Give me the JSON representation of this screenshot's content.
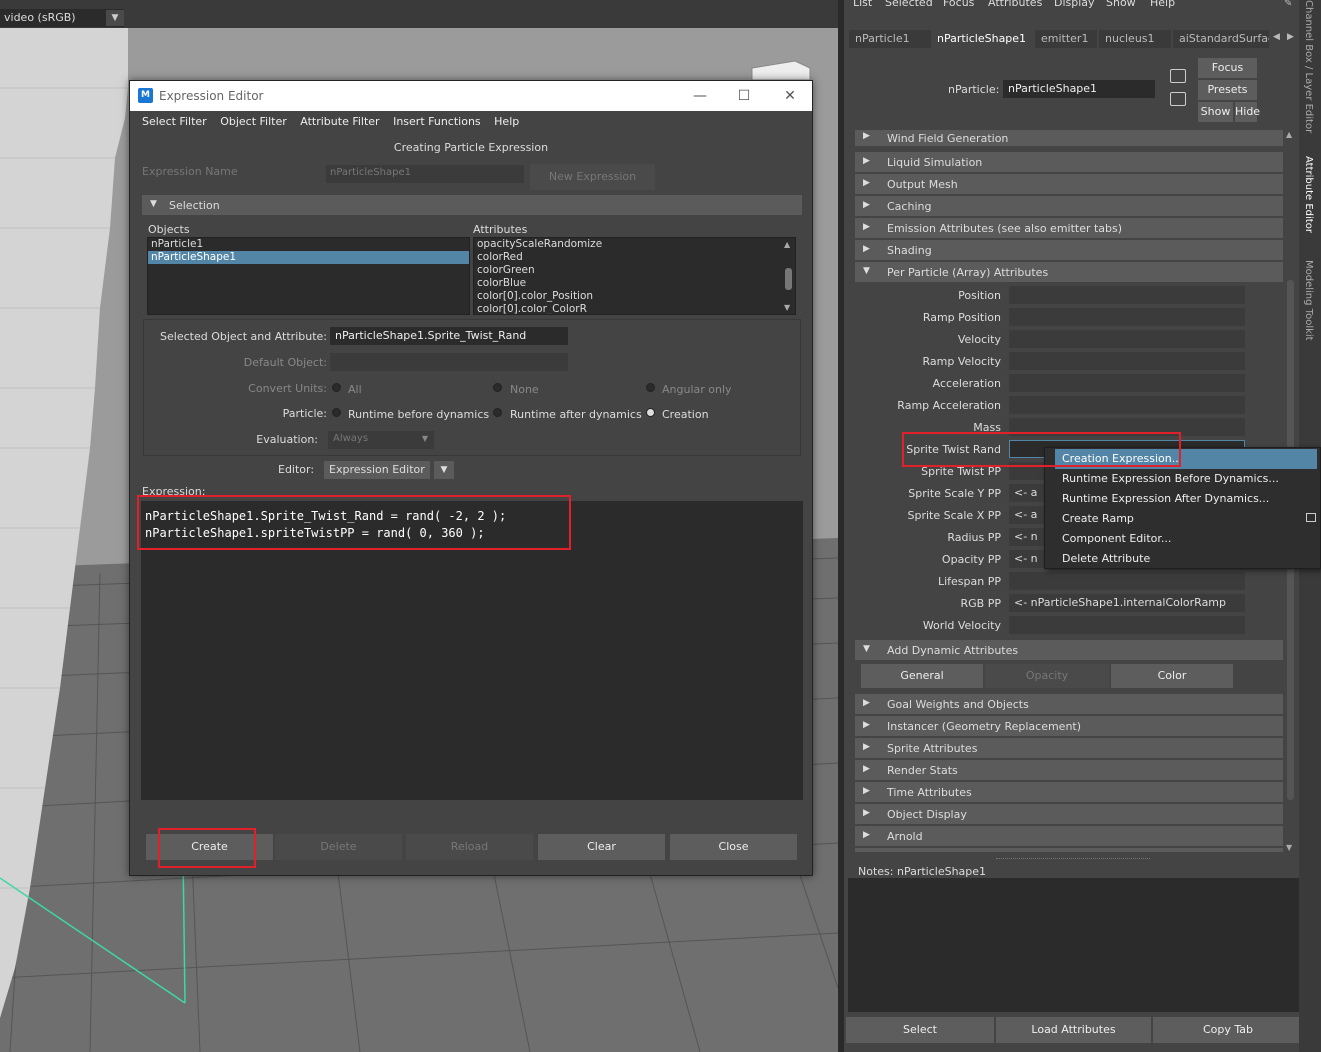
{
  "viewport": {
    "color_space": "video (sRGB)",
    "accent_green": "#3ed7a8"
  },
  "expression_editor": {
    "title": "Expression Editor",
    "menu": [
      "Select Filter",
      "Object Filter",
      "Attribute Filter",
      "Insert Functions",
      "Help"
    ],
    "header": "Creating Particle Expression",
    "expression_name_label": "Expression Name",
    "expression_name_value": "nParticleShape1",
    "new_expression_button": "New Expression",
    "selection_section": "Selection",
    "objects_label": "Objects",
    "objects": [
      "nParticle1",
      "nParticleShape1"
    ],
    "selected_object": "nParticleShape1",
    "attributes_label": "Attributes",
    "attributes": [
      "opacityScaleRandomize",
      "colorRed",
      "colorGreen",
      "colorBlue",
      "color[0].color_Position",
      "color[0].color_ColorR"
    ],
    "selected_object_attr_label": "Selected Object and Attribute:",
    "selected_object_attr_value": "nParticleShape1.Sprite_Twist_Rand",
    "default_object_label": "Default Object:",
    "convert_units_label": "Convert Units:",
    "convert_units_options": [
      "All",
      "None",
      "Angular only"
    ],
    "particle_label": "Particle:",
    "particle_options": [
      "Runtime before dynamics",
      "Runtime after dynamics",
      "Creation"
    ],
    "particle_selected": "Creation",
    "evaluation_label": "Evaluation:",
    "evaluation_value": "Always",
    "editor_label": "Editor:",
    "editor_value": "Expression Editor",
    "expression_label": "Expression:",
    "code_lines": [
      "nParticleShape1.Sprite_Twist_Rand = rand( -2, 2 );",
      "nParticleShape1.spriteTwistPP = rand( 0, 360 );"
    ],
    "buttons": {
      "create": "Create",
      "delete": "Delete",
      "reload": "Reload",
      "clear": "Clear",
      "close": "Close"
    }
  },
  "attribute_editor": {
    "menu": [
      "List",
      "Selected",
      "Focus",
      "Attributes",
      "Display",
      "Show",
      "Help"
    ],
    "node_tabs": [
      "nParticle1",
      "nParticleShape1",
      "emitter1",
      "nucleus1",
      "aiStandardSurfac"
    ],
    "active_tab": "nParticleShape1",
    "node_label": "nParticle:",
    "node_value": "nParticleShape1",
    "focus_button": "Focus",
    "presets_button": "Presets",
    "show_button": "Show",
    "hide_button": "Hide",
    "sections_top": [
      "Wind Field Generation",
      "Liquid Simulation",
      "Output Mesh",
      "Caching",
      "Emission Attributes (see also emitter tabs)",
      "Shading",
      "Per Particle (Array) Attributes"
    ],
    "per_particle_attrs": [
      {
        "label": "Position",
        "value": ""
      },
      {
        "label": "Ramp Position",
        "value": ""
      },
      {
        "label": "Velocity",
        "value": ""
      },
      {
        "label": "Ramp Velocity",
        "value": ""
      },
      {
        "label": "Acceleration",
        "value": ""
      },
      {
        "label": "Ramp Acceleration",
        "value": ""
      },
      {
        "label": "Mass",
        "value": ""
      },
      {
        "label": "Sprite Twist Rand",
        "value": ""
      },
      {
        "label": "Sprite Twist PP",
        "value": ""
      },
      {
        "label": "Sprite Scale Y PP",
        "value": "<- a"
      },
      {
        "label": "Sprite Scale X PP",
        "value": "<- a"
      },
      {
        "label": "Radius PP",
        "value": "<- n"
      },
      {
        "label": "Opacity PP",
        "value": "<- n"
      },
      {
        "label": "Lifespan PP",
        "value": ""
      },
      {
        "label": "RGB PP",
        "value": "<- nParticleShape1.internalColorRamp"
      },
      {
        "label": "World Velocity",
        "value": ""
      }
    ],
    "add_dynamic_section": "Add Dynamic Attributes",
    "dynamic_tabs": [
      "General",
      "Opacity",
      "Color"
    ],
    "sections_bottom": [
      "Goal Weights and Objects",
      "Instancer (Geometry Replacement)",
      "Sprite Attributes",
      "Render Stats",
      "Time Attributes",
      "Object Display",
      "Arnold"
    ],
    "notes_label": "Notes:  nParticleShape1",
    "bottom_buttons": [
      "Select",
      "Load Attributes",
      "Copy Tab"
    ],
    "side_tabs": [
      "Channel Box / Layer Editor",
      "Attribute Editor",
      "Modeling Toolkit"
    ]
  },
  "context_menu": {
    "items": [
      "Creation Expression...",
      "Runtime Expression Before Dynamics...",
      "Runtime Expression After Dynamics...",
      "Create Ramp",
      "Component Editor...",
      "Delete Attribute"
    ],
    "highlighted": "Creation Expression..."
  },
  "colors": {
    "highlight": "#5285a6",
    "annotation_red": "#e0202a",
    "panel_bg": "#444444"
  }
}
